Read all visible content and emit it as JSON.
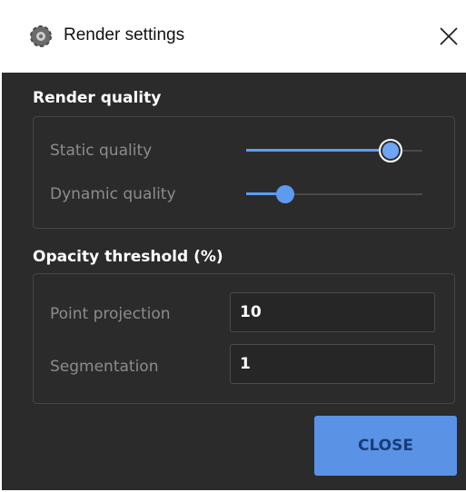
{
  "window": {
    "title": "Render settings",
    "app_icon": "app-gear-icon",
    "close_icon": "close-icon"
  },
  "render_quality": {
    "title": "Render quality",
    "static_quality": {
      "label": "Static quality",
      "value_fraction": 0.82
    },
    "dynamic_quality": {
      "label": "Dynamic quality",
      "value_fraction": 0.22
    }
  },
  "opacity_threshold": {
    "title": "Opacity threshold (%)",
    "point_projection": {
      "label": "Point projection",
      "value": "10"
    },
    "segmentation": {
      "label": "Segmentation",
      "value": "1"
    }
  },
  "footer": {
    "close_label": "CLOSE"
  },
  "colors": {
    "accent": "#5d9bf0",
    "background": "#2b2b2b",
    "titlebar": "#ffffff",
    "label_text": "#8c8c8c"
  }
}
